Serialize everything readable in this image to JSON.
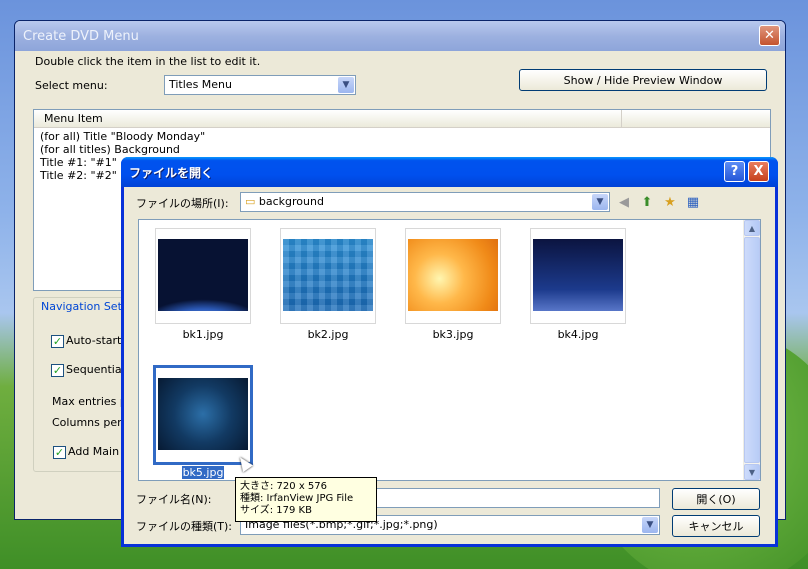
{
  "background_window": {
    "title": "Create DVD Menu",
    "instruction": "Double click the item in the list to edit it.",
    "select_menu_label": "Select menu:",
    "select_menu_value": "Titles Menu",
    "preview_button": "Show / Hide Preview Window",
    "list_header": "Menu Item",
    "list_rows": [
      "(for all) Title \"Bloody Monday\"",
      "(for all titles) Background",
      "Title #1: \"#1\"",
      "Title #2: \"#2\""
    ],
    "nav_group_label": "Navigation Setti",
    "auto_start": "Auto-start",
    "sequential": "Sequential",
    "max_entries": "Max entries p",
    "columns_per": "Columns per p",
    "add_main": "Add Main I"
  },
  "open_dialog": {
    "title": "ファイルを開く",
    "help": "?",
    "close": "X",
    "look_in_label": "ファイルの場所(I):",
    "look_in_value": "background",
    "files": [
      {
        "name": "bk1.jpg"
      },
      {
        "name": "bk2.jpg"
      },
      {
        "name": "bk3.jpg"
      },
      {
        "name": "bk4.jpg"
      },
      {
        "name": "bk5.jpg"
      }
    ],
    "filename_label": "ファイル名(N):",
    "filetype_label": "ファイルの種類(T):",
    "filetype_value": "Image files(*.bmp;*.gif;*.jpg;*.png)",
    "open_button": "開く(O)",
    "cancel_button": "キャンセル",
    "tooltip": {
      "line1": "大きさ: 720 x 576",
      "line2": "種類: IrfanView JPG File",
      "line3": "サイズ: 179 KB"
    }
  }
}
